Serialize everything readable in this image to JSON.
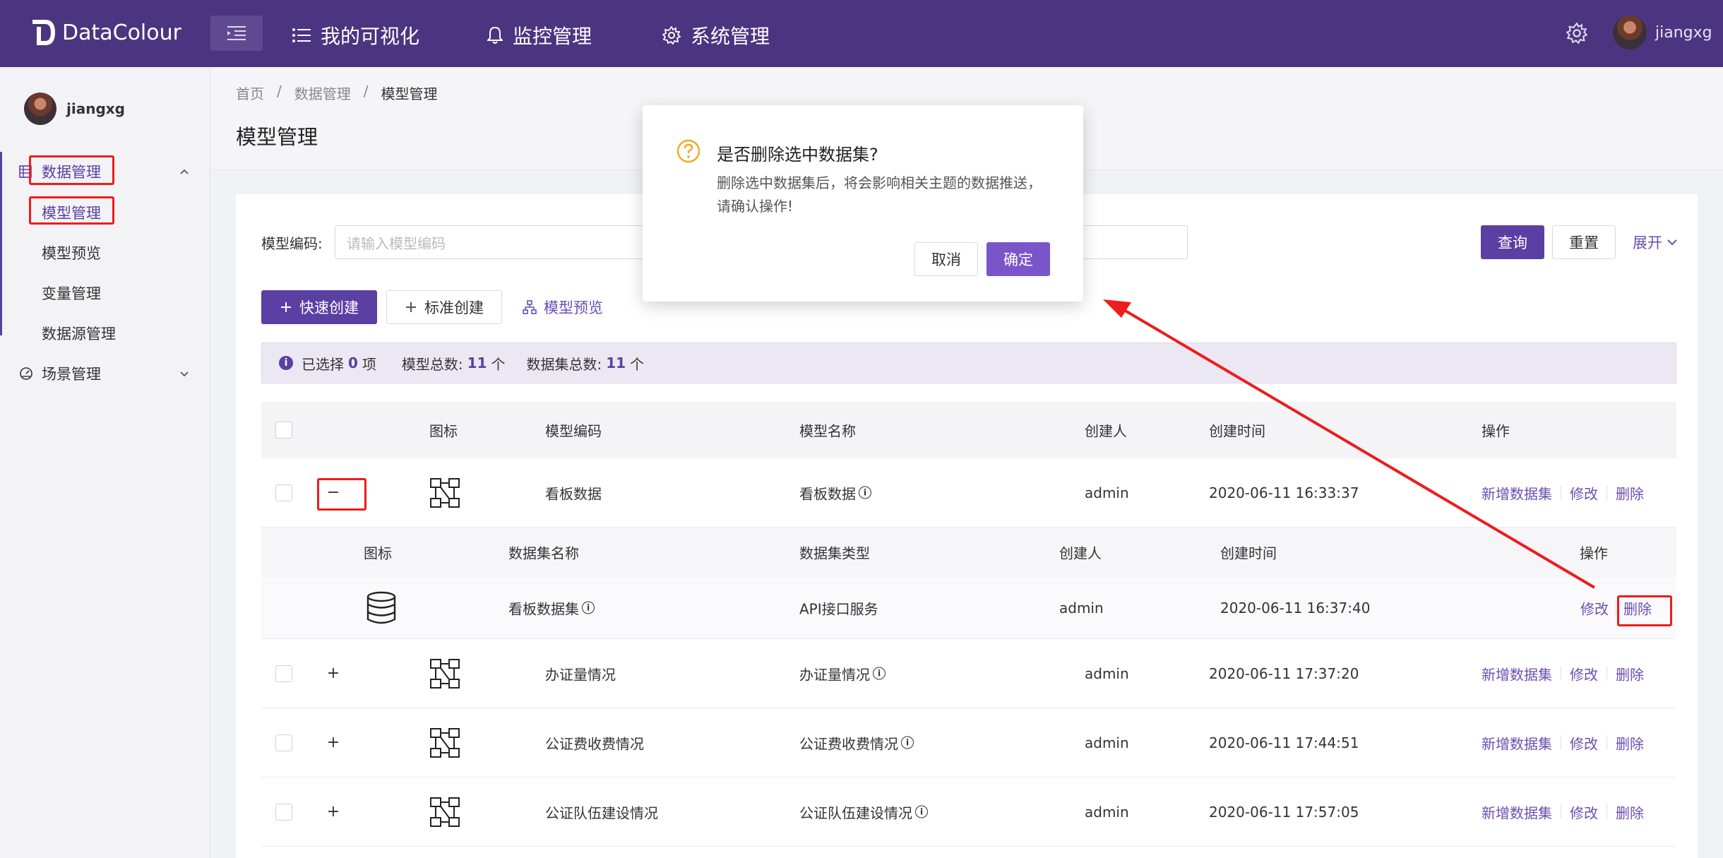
{
  "app": {
    "logo_text": "DataColour"
  },
  "topnav": {
    "items": [
      {
        "label": "我的可视化",
        "icon": "list-icon"
      },
      {
        "label": "监控管理",
        "icon": "bell-icon"
      },
      {
        "label": "系统管理",
        "icon": "gear-icon"
      }
    ],
    "username": "jiangxg"
  },
  "sidebar": {
    "username": "jiangxg",
    "groups": [
      {
        "label": "数据管理",
        "icon": "table-icon",
        "expanded": true,
        "items": [
          {
            "label": "模型管理",
            "active": true
          },
          {
            "label": "模型预览"
          },
          {
            "label": "变量管理"
          },
          {
            "label": "数据源管理"
          }
        ]
      },
      {
        "label": "场景管理",
        "icon": "dashboard-icon",
        "expanded": false,
        "items": []
      }
    ]
  },
  "breadcrumb": [
    "首页",
    "数据管理",
    "模型管理"
  ],
  "breadcrumb_sep": "/",
  "page_title": "模型管理",
  "search": {
    "label": "模型编码:",
    "placeholder": "请输入模型编码",
    "query_label": "查询",
    "reset_label": "重置",
    "expand_label": "展开"
  },
  "actions": {
    "quick_create": "快速创建",
    "standard_create": "标准创建",
    "model_preview": "模型预览"
  },
  "info_bar": {
    "selected_prefix": "已选择",
    "selected_count": "0",
    "selected_suffix": "项",
    "model_total_label": "模型总数:",
    "model_total": "11",
    "model_total_unit": "个",
    "dataset_total_label": "数据集总数:",
    "dataset_total": "11",
    "dataset_total_unit": "个"
  },
  "table": {
    "columns": [
      "图标",
      "模型编码",
      "模型名称",
      "创建人",
      "创建时间",
      "操作"
    ],
    "rows": [
      {
        "code": "看板数据",
        "name": "看板数据",
        "creator": "admin",
        "time": "2020-06-11 16:33:37",
        "expanded": true
      },
      {
        "code": "办证量情况",
        "name": "办证量情况",
        "creator": "admin",
        "time": "2020-06-11 17:37:20",
        "expanded": false
      },
      {
        "code": "公证费收费情况",
        "name": "公证费收费情况",
        "creator": "admin",
        "time": "2020-06-11 17:44:51",
        "expanded": false
      },
      {
        "code": "公证队伍建设情况",
        "name": "公证队伍建设情况",
        "creator": "admin",
        "time": "2020-06-11 17:57:05",
        "expanded": false
      }
    ],
    "row_ops": [
      "新增数据集",
      "修改",
      "删除"
    ],
    "sub_columns": [
      "图标",
      "数据集名称",
      "数据集类型",
      "创建人",
      "创建时间",
      "操作"
    ],
    "sub_row": {
      "name": "看板数据集",
      "type": "API接口服务",
      "creator": "admin",
      "time": "2020-06-11 16:37:40"
    },
    "sub_ops": [
      "修改",
      "删除"
    ]
  },
  "modal": {
    "title": "是否删除选中数据集?",
    "body": "删除选中数据集后，将会影响相关主题的数据推送，请确认操作!",
    "cancel_label": "取消",
    "ok_label": "确定"
  },
  "colors": {
    "topbar": "#4b3580",
    "primary": "#5b3fa3",
    "modal_ok": "#7a55c9",
    "highlight_box": "#ee1c1c",
    "warning_icon": "#f5a623"
  }
}
